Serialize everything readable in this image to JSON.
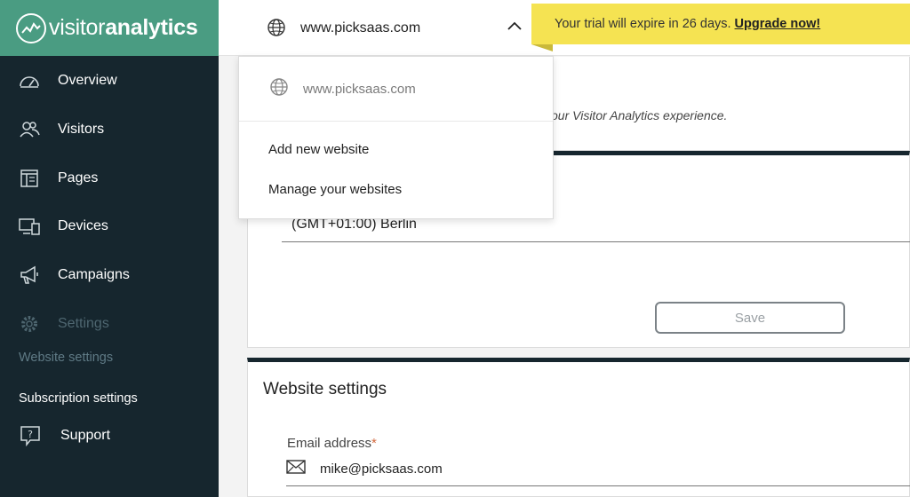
{
  "brand": {
    "name_light": "visitor",
    "name_bold": "analytics"
  },
  "sidebar": {
    "items": [
      {
        "label": "Overview",
        "icon": "gauge-icon"
      },
      {
        "label": "Visitors",
        "icon": "users-icon"
      },
      {
        "label": "Pages",
        "icon": "pages-icon"
      },
      {
        "label": "Devices",
        "icon": "devices-icon"
      },
      {
        "label": "Campaigns",
        "icon": "megaphone-icon"
      },
      {
        "label": "Settings",
        "icon": "gear-icon"
      }
    ],
    "sub_items": [
      {
        "label": "Website settings"
      },
      {
        "label": "Subscription settings"
      }
    ],
    "support": {
      "label": "Support",
      "icon": "help-chat-icon"
    }
  },
  "topbar": {
    "site": "www.picksaas.com",
    "trial_text": "Your trial will expire in 26 days.",
    "upgrade_label": "Upgrade now!"
  },
  "dropdown": {
    "current_site": "www.picksaas.com",
    "items": [
      "Add new website",
      "Manage your websites"
    ]
  },
  "content": {
    "intro_partial": "our Visitor Analytics experience.",
    "timezone_value": "(GMT+01:00) Berlin",
    "save_label": "Save",
    "website_settings_title": "Website settings",
    "email_label": "Email address",
    "email_required_mark": "*",
    "email_value": "mike@picksaas.com"
  },
  "colors": {
    "sidebar_bg": "#16262e",
    "brand_green": "#4a9c82",
    "banner_yellow": "#f5e352"
  }
}
